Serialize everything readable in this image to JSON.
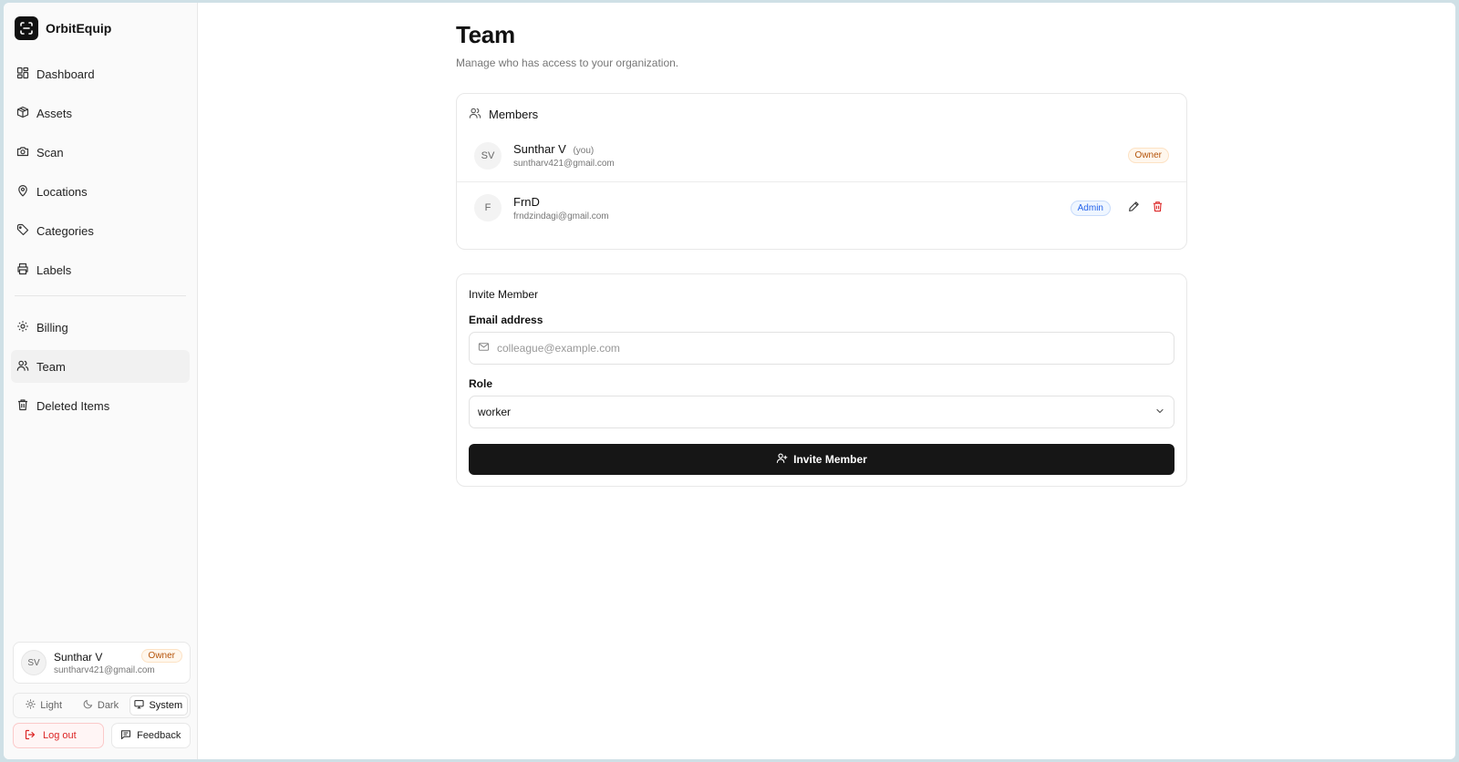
{
  "brand": {
    "name": "OrbitEquip"
  },
  "sidebar": {
    "items": [
      {
        "label": "Dashboard",
        "icon": "dashboard-icon"
      },
      {
        "label": "Assets",
        "icon": "box-icon"
      },
      {
        "label": "Scan",
        "icon": "camera-icon"
      },
      {
        "label": "Locations",
        "icon": "map-pin-icon"
      },
      {
        "label": "Categories",
        "icon": "tag-icon"
      },
      {
        "label": "Labels",
        "icon": "printer-icon"
      }
    ],
    "secondary_items": [
      {
        "label": "Billing",
        "icon": "gear-icon"
      },
      {
        "label": "Team",
        "icon": "users-icon",
        "active": true
      },
      {
        "label": "Deleted Items",
        "icon": "trash-icon"
      }
    ],
    "user": {
      "initials": "SV",
      "name": "Sunthar V",
      "email": "suntharv421@gmail.com",
      "role": "Owner"
    },
    "theme": {
      "options": [
        "Light",
        "Dark",
        "System"
      ],
      "selected": "System"
    },
    "logout_label": "Log out",
    "feedback_label": "Feedback"
  },
  "page": {
    "title": "Team",
    "subtitle": "Manage who has access to your organization."
  },
  "members": {
    "header": "Members",
    "rows": [
      {
        "initials": "SV",
        "name": "Sunthar V",
        "you": "(you)",
        "email": "suntharv421@gmail.com",
        "role": "Owner"
      },
      {
        "initials": "F",
        "name": "FrnD",
        "you": "",
        "email": "frndzindagi@gmail.com",
        "role": "Admin"
      }
    ]
  },
  "invite": {
    "title": "Invite Member",
    "email_label": "Email address",
    "email_placeholder": "colleague@example.com",
    "email_value": "",
    "role_label": "Role",
    "role_value": "worker",
    "button_label": "Invite Member"
  },
  "colors": {
    "primary_button": "#161616",
    "owner_badge": "#b45309",
    "admin_badge": "#2563eb",
    "danger": "#dc2626"
  }
}
